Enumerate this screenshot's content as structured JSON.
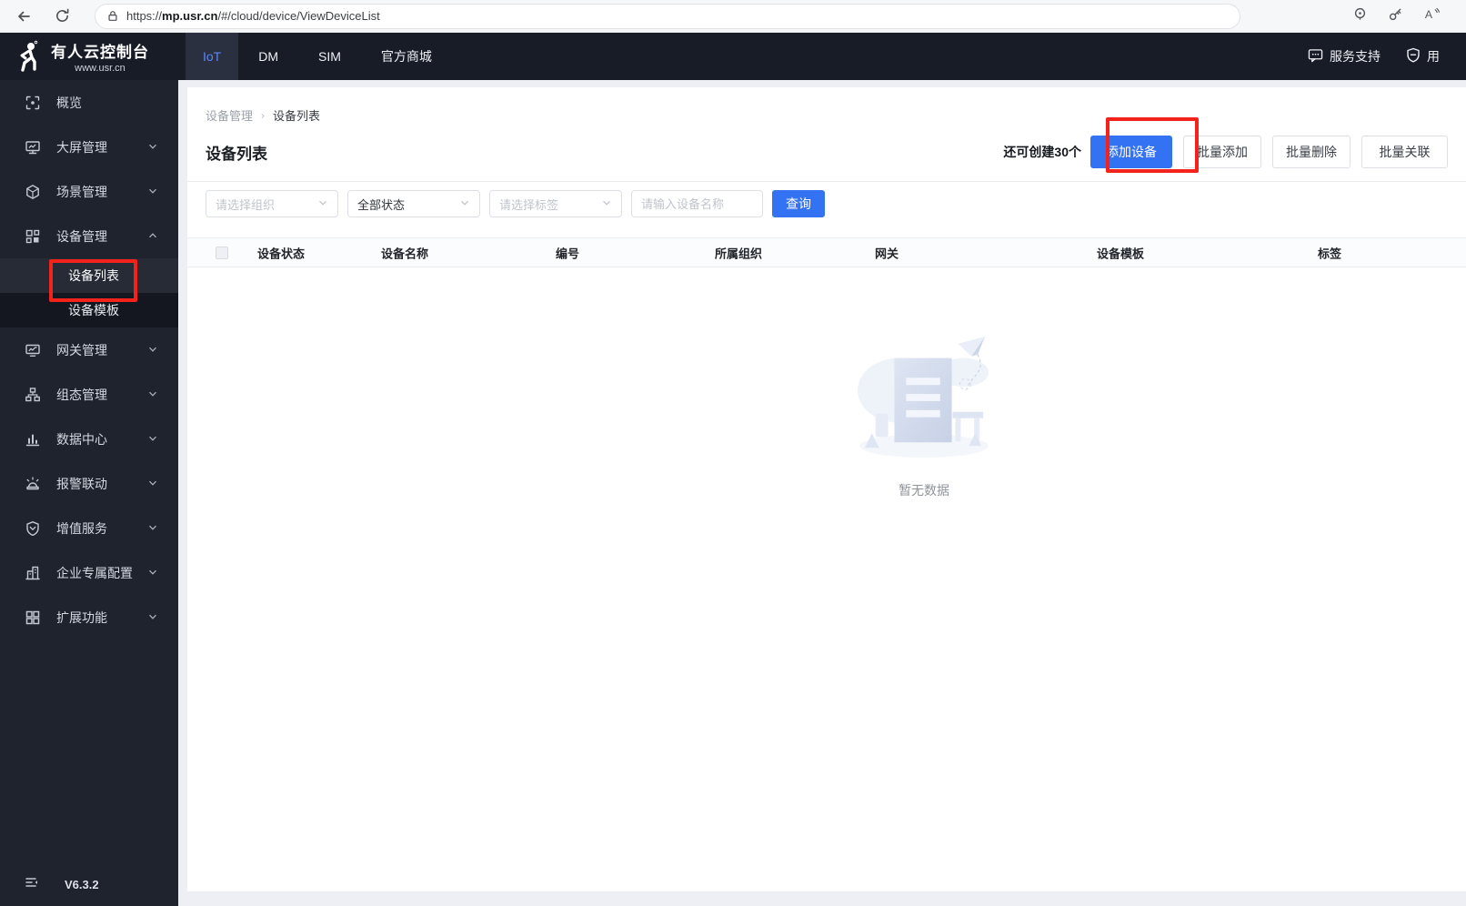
{
  "browser": {
    "url_scheme": "https://",
    "url_domain": "mp.usr.cn",
    "url_path": "/#/cloud/device/ViewDeviceList"
  },
  "header": {
    "logo_title": "有人云控制台",
    "logo_subtitle": "www.usr.cn",
    "tabs": [
      {
        "label": "IoT"
      },
      {
        "label": "DM"
      },
      {
        "label": "SIM"
      },
      {
        "label": "官方商城"
      }
    ],
    "support_label": "服务支持",
    "user_label": "用"
  },
  "sidebar": {
    "items": [
      {
        "label": "概览",
        "icon": "overview-icon"
      },
      {
        "label": "大屏管理",
        "icon": "bigscreen-icon"
      },
      {
        "label": "场景管理",
        "icon": "scene-icon"
      },
      {
        "label": "设备管理",
        "icon": "device-icon"
      },
      {
        "label": "网关管理",
        "icon": "gateway-icon"
      },
      {
        "label": "组态管理",
        "icon": "scada-icon"
      },
      {
        "label": "数据中心",
        "icon": "datacenter-icon"
      },
      {
        "label": "报警联动",
        "icon": "alarm-icon"
      },
      {
        "label": "增值服务",
        "icon": "value-service-icon"
      },
      {
        "label": "企业专属配置",
        "icon": "enterprise-icon"
      },
      {
        "label": "扩展功能",
        "icon": "extension-icon"
      }
    ],
    "device_children": [
      {
        "label": "设备列表"
      },
      {
        "label": "设备模板"
      }
    ],
    "version": "V6.3.2"
  },
  "main": {
    "breadcrumb": {
      "parent": "设备管理",
      "current": "设备列表"
    },
    "title": "设备列表",
    "quota_text": "还可创建30个",
    "add_button": "添加设备",
    "batch_add_button": "批量添加",
    "batch_delete_button": "批量删除",
    "batch_link_button": "批量关联",
    "filters": {
      "org_placeholder": "请选择组织",
      "status_value": "全部状态",
      "tag_placeholder": "请选择标签",
      "name_placeholder": "请输入设备名称",
      "search_button": "查询"
    },
    "table_columns": [
      "设备状态",
      "设备名称",
      "编号",
      "所属组织",
      "网关",
      "设备模板",
      "标签"
    ],
    "empty_text": "暂无数据"
  },
  "colors": {
    "accent_blue": "#3372f2",
    "annotation_red": "#f3231c",
    "header_bg": "#181c27",
    "sidebar_bg": "#1f232e",
    "submenu_bg": "#14171f"
  }
}
